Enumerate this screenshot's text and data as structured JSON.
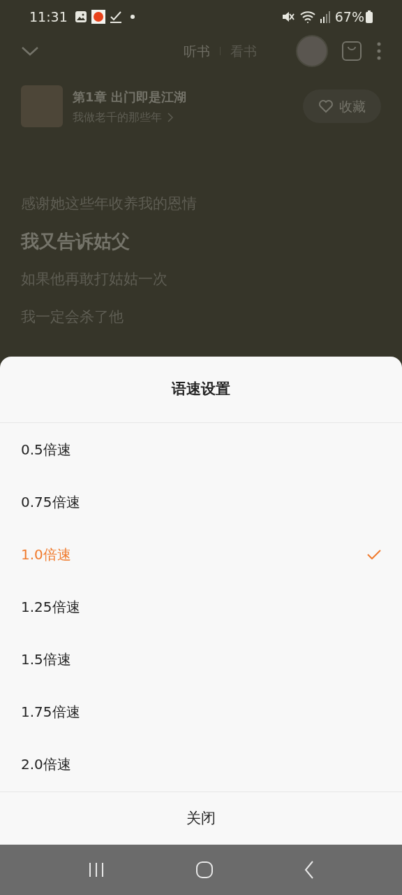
{
  "status_bar": {
    "time": "11:31",
    "battery": "67%"
  },
  "header": {
    "tabs": [
      {
        "label": "听书",
        "selected": true
      },
      {
        "label": "看书",
        "selected": false
      }
    ]
  },
  "book": {
    "chapter": "第1章 出门即是江湖",
    "title": "我做老千的那些年",
    "favorite": {
      "label": "收藏",
      "on": false
    }
  },
  "lyrics": [
    {
      "text": "感谢她这些年收养我的恩情",
      "current": false
    },
    {
      "text": "我又告诉姑父",
      "current": true
    },
    {
      "text": "如果他再敢打姑姑一次",
      "current": false
    },
    {
      "text": "我一定会杀了他",
      "current": false
    }
  ],
  "sheet": {
    "title": "语速设置",
    "options": [
      {
        "label": "0.5倍速",
        "selected": false
      },
      {
        "label": "0.75倍速",
        "selected": false
      },
      {
        "label": "1.0倍速",
        "selected": true
      },
      {
        "label": "1.25倍速",
        "selected": false
      },
      {
        "label": "1.5倍速",
        "selected": false
      },
      {
        "label": "1.75倍速",
        "selected": false
      },
      {
        "label": "2.0倍速",
        "selected": false
      }
    ],
    "close": "关闭"
  }
}
